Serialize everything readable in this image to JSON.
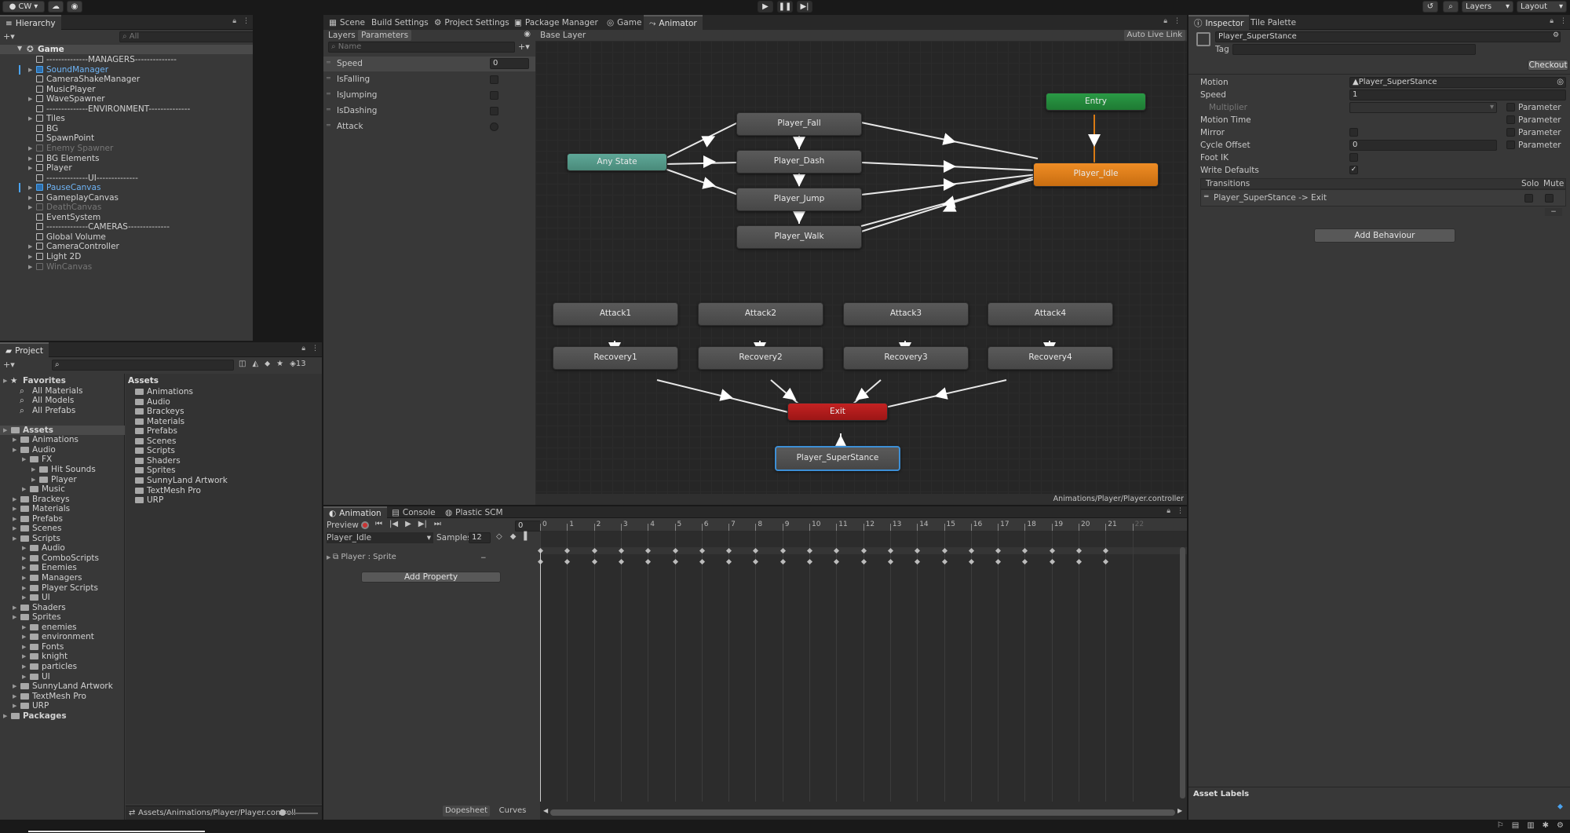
{
  "topbar": {
    "account": "CW",
    "layers": "Layers",
    "layout": "Layout"
  },
  "hierarchy": {
    "tab": "Hierarchy",
    "search_placeholder": "All",
    "scene": "Game",
    "items": [
      {
        "label": "--------------MANAGERS--------------",
        "style": "normal",
        "arrow": false
      },
      {
        "label": "SoundManager",
        "style": "prefab",
        "arrow": true
      },
      {
        "label": "CameraShakeManager",
        "style": "normal",
        "arrow": false
      },
      {
        "label": "MusicPlayer",
        "style": "normal",
        "arrow": false
      },
      {
        "label": "WaveSpawner",
        "style": "normal",
        "arrow": true
      },
      {
        "label": "--------------ENVIRONMENT--------------",
        "style": "normal",
        "arrow": false
      },
      {
        "label": "Tiles",
        "style": "normal",
        "arrow": true
      },
      {
        "label": "BG",
        "style": "normal",
        "arrow": false
      },
      {
        "label": "SpawnPoint",
        "style": "normal",
        "arrow": false
      },
      {
        "label": "Enemy Spawner",
        "style": "dim",
        "arrow": true
      },
      {
        "label": "BG Elements",
        "style": "normal",
        "arrow": true
      },
      {
        "label": "Player",
        "style": "normal",
        "arrow": true
      },
      {
        "label": "--------------UI--------------",
        "style": "normal",
        "arrow": false
      },
      {
        "label": "PauseCanvas",
        "style": "prefab",
        "arrow": true
      },
      {
        "label": "GameplayCanvas",
        "style": "normal",
        "arrow": true
      },
      {
        "label": "DeathCanvas",
        "style": "dim",
        "arrow": true
      },
      {
        "label": "EventSystem",
        "style": "normal",
        "arrow": false
      },
      {
        "label": "--------------CAMERAS--------------",
        "style": "normal",
        "arrow": false
      },
      {
        "label": "Global Volume",
        "style": "normal",
        "arrow": false
      },
      {
        "label": "CameraController",
        "style": "normal",
        "arrow": true
      },
      {
        "label": "Light 2D",
        "style": "normal",
        "arrow": true
      },
      {
        "label": "WinCanvas",
        "style": "dim",
        "arrow": true
      }
    ]
  },
  "project": {
    "tab": "Project",
    "count": "13",
    "tree": [
      {
        "label": "Favorites",
        "indent": 0,
        "kind": "star",
        "bold": true
      },
      {
        "label": "All Materials",
        "indent": 1,
        "kind": "search",
        "bold": false
      },
      {
        "label": "All Models",
        "indent": 1,
        "kind": "search",
        "bold": false
      },
      {
        "label": "All Prefabs",
        "indent": 1,
        "kind": "search",
        "bold": false
      },
      {
        "label": "",
        "indent": 0,
        "kind": "blank",
        "bold": false
      },
      {
        "label": "Assets",
        "indent": 0,
        "kind": "folder",
        "bold": true
      },
      {
        "label": "Animations",
        "indent": 1,
        "kind": "folder",
        "bold": false
      },
      {
        "label": "Audio",
        "indent": 1,
        "kind": "folder",
        "bold": false
      },
      {
        "label": "FX",
        "indent": 2,
        "kind": "folder",
        "bold": false
      },
      {
        "label": "Hit Sounds",
        "indent": 3,
        "kind": "folder",
        "bold": false
      },
      {
        "label": "Player",
        "indent": 3,
        "kind": "folder",
        "bold": false
      },
      {
        "label": "Music",
        "indent": 2,
        "kind": "folder",
        "bold": false
      },
      {
        "label": "Brackeys",
        "indent": 1,
        "kind": "folder",
        "bold": false
      },
      {
        "label": "Materials",
        "indent": 1,
        "kind": "folder",
        "bold": false
      },
      {
        "label": "Prefabs",
        "indent": 1,
        "kind": "folder",
        "bold": false
      },
      {
        "label": "Scenes",
        "indent": 1,
        "kind": "folder",
        "bold": false
      },
      {
        "label": "Scripts",
        "indent": 1,
        "kind": "folder",
        "bold": false
      },
      {
        "label": "Audio",
        "indent": 2,
        "kind": "folder",
        "bold": false
      },
      {
        "label": "ComboScripts",
        "indent": 2,
        "kind": "folder",
        "bold": false
      },
      {
        "label": "Enemies",
        "indent": 2,
        "kind": "folder",
        "bold": false
      },
      {
        "label": "Managers",
        "indent": 2,
        "kind": "folder",
        "bold": false
      },
      {
        "label": "Player Scripts",
        "indent": 2,
        "kind": "folder",
        "bold": false
      },
      {
        "label": "UI",
        "indent": 2,
        "kind": "folder",
        "bold": false
      },
      {
        "label": "Shaders",
        "indent": 1,
        "kind": "folder",
        "bold": false
      },
      {
        "label": "Sprites",
        "indent": 1,
        "kind": "folder",
        "bold": false
      },
      {
        "label": "enemies",
        "indent": 2,
        "kind": "folder",
        "bold": false
      },
      {
        "label": "environment",
        "indent": 2,
        "kind": "folder",
        "bold": false
      },
      {
        "label": "Fonts",
        "indent": 2,
        "kind": "folder",
        "bold": false
      },
      {
        "label": "knight",
        "indent": 2,
        "kind": "folder",
        "bold": false
      },
      {
        "label": "particles",
        "indent": 2,
        "kind": "folder",
        "bold": false
      },
      {
        "label": "UI",
        "indent": 2,
        "kind": "folder",
        "bold": false
      },
      {
        "label": "SunnyLand Artwork",
        "indent": 1,
        "kind": "folder",
        "bold": false
      },
      {
        "label": "TextMesh Pro",
        "indent": 1,
        "kind": "folder",
        "bold": false
      },
      {
        "label": "URP",
        "indent": 1,
        "kind": "folder",
        "bold": false
      },
      {
        "label": "Packages",
        "indent": 0,
        "kind": "folder",
        "bold": true
      }
    ],
    "assets_header": "Assets",
    "assets": [
      "Animations",
      "Audio",
      "Brackeys",
      "Materials",
      "Prefabs",
      "Scenes",
      "Scripts",
      "Shaders",
      "Sprites",
      "SunnyLand Artwork",
      "TextMesh Pro",
      "URP"
    ],
    "path": "Assets/Animations/Player/Player.controll"
  },
  "center_tabs": [
    "Scene",
    "Build Settings",
    "Project Settings",
    "Package Manager",
    "Game",
    "Animator"
  ],
  "animator": {
    "layers_tab": "Layers",
    "parameters_tab": "Parameters",
    "name_placeholder": "Name",
    "base_layer": "Base Layer",
    "auto_live_link": "Auto Live Link",
    "footer_path": "Animations/Player/Player.controller",
    "params": [
      {
        "name": "Speed",
        "type": "float",
        "value": "0"
      },
      {
        "name": "IsFalling",
        "type": "bool",
        "value": ""
      },
      {
        "name": "IsJumping",
        "type": "bool",
        "value": ""
      },
      {
        "name": "IsDashing",
        "type": "bool",
        "value": ""
      },
      {
        "name": "Attack",
        "type": "trigger",
        "value": ""
      }
    ],
    "states": {
      "any": "Any State",
      "entry": "Entry",
      "idle": "Player_Idle",
      "exit": "Exit",
      "fall": "Player_Fall",
      "dash": "Player_Dash",
      "jump": "Player_Jump",
      "walk": "Player_Walk",
      "a1": "Attack1",
      "a2": "Attack2",
      "a3": "Attack3",
      "a4": "Attack4",
      "r1": "Recovery1",
      "r2": "Recovery2",
      "r3": "Recovery3",
      "r4": "Recovery4",
      "super": "Player_SuperStance"
    }
  },
  "animation": {
    "tabs": [
      "Animation",
      "Console",
      "Plastic SCM"
    ],
    "preview": "Preview",
    "frame": "0",
    "clip": "Player_Idle",
    "samples_label": "Samples",
    "samples": "12",
    "property": "Player : Sprite",
    "add_property": "Add Property",
    "dopesheet": "Dopesheet",
    "curves": "Curves",
    "ticks": [
      "0",
      "1",
      "2",
      "3",
      "4",
      "5",
      "6",
      "7",
      "8",
      "9",
      "10",
      "11",
      "12",
      "13",
      "14",
      "15",
      "16",
      "17",
      "18",
      "19",
      "20",
      "21",
      "22"
    ]
  },
  "inspector": {
    "tabs": [
      "Inspector",
      "Tile Palette"
    ],
    "name": "Player_SuperStance",
    "tag_label": "Tag",
    "checkout": "Checkout",
    "motion_label": "Motion",
    "motion_value": "Player_SuperStance",
    "speed_label": "Speed",
    "speed_value": "1",
    "multiplier_label": "Multiplier",
    "parameter": "Parameter",
    "motion_time_label": "Motion Time",
    "mirror_label": "Mirror",
    "cycle_offset_label": "Cycle Offset",
    "cycle_offset_value": "0",
    "foot_ik_label": "Foot IK",
    "write_defaults_label": "Write Defaults",
    "transitions_label": "Transitions",
    "solo": "Solo",
    "mute": "Mute",
    "transition": "Player_SuperStance -> Exit",
    "add_behaviour": "Add Behaviour",
    "asset_labels": "Asset Labels"
  },
  "colors": {
    "entry": "#1e7a33",
    "idle": "#d97a14",
    "exit": "#b01a1a",
    "any": "#4f9a8a",
    "accent": "#4aa3f0"
  }
}
